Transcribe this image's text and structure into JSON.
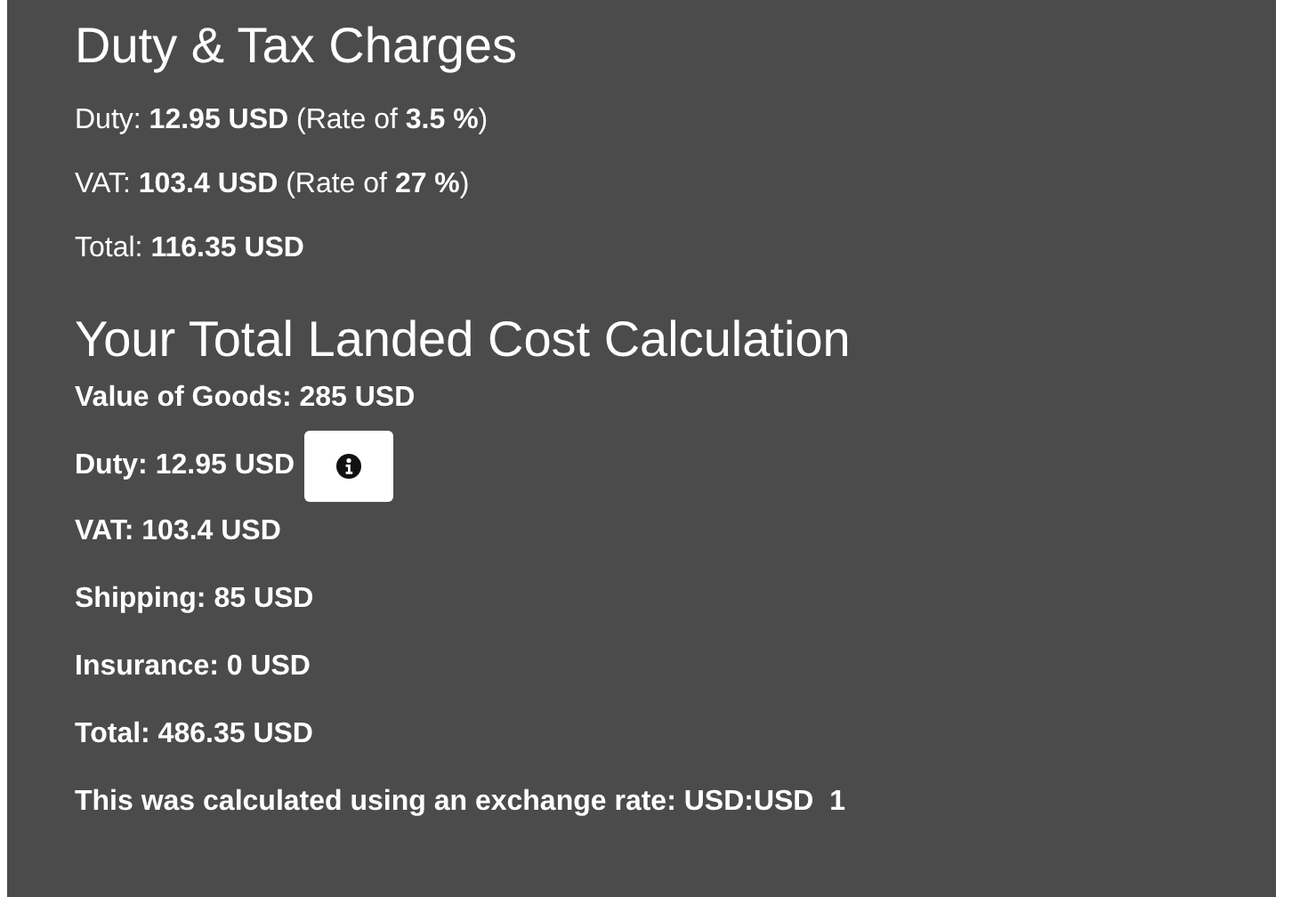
{
  "duty_tax_charges": {
    "title": "Duty & Tax Charges",
    "lines": [
      "Duty: **12.95 USD** (Rate of **3.5 %**)",
      "VAT: **103.4 USD** (Rate of **27 %**)",
      "Total: **116.35 USD**"
    ]
  },
  "landed_cost": {
    "title": "Your Total Landed Cost Calculation",
    "lines": [
      {
        "text": "Value of Goods: 285 USD",
        "kind": "text"
      },
      {
        "text": "Duty: 12.95 USD",
        "kind": "info"
      },
      {
        "text": "VAT: 103.4 USD",
        "kind": "text"
      },
      {
        "text": "Shipping: 85 USD",
        "kind": "text"
      },
      {
        "text": "Insurance: 0 USD",
        "kind": "text"
      },
      {
        "text": "Total: 486.35 USD",
        "kind": "text"
      },
      {
        "text": "This was calculated using an exchange rate: USD:USD  1",
        "kind": "text"
      }
    ]
  }
}
